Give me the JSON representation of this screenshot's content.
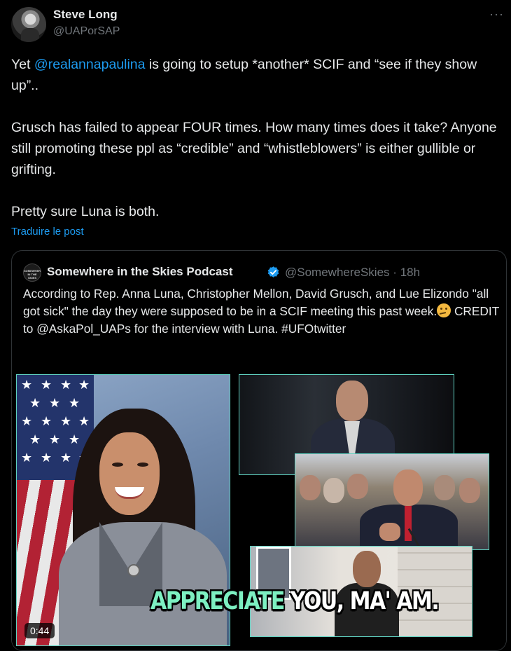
{
  "author": {
    "name": "Steve Long",
    "handle": "@UAPorSAP"
  },
  "more_icon": "more-horizontal-icon",
  "tweet": {
    "line1_prefix": "Yet ",
    "mention": "@realannapaulina",
    "line1_suffix": " is going to setup *another* SCIF and “see if they show up”..",
    "paragraph2": "Grusch has failed to appear FOUR times. How many times does it take? Anyone still promoting these ppl as “credible” and “whistleblowers” is either gullible or grifting.",
    "paragraph3": "Pretty sure Luna is both."
  },
  "translate_label": "Traduire le post",
  "quote": {
    "avatar_text": "SOMEWHERE IN THE SKIES",
    "name": "Somewhere in the Skies Podcast",
    "handle": "@SomewhereSkies",
    "separator": "·",
    "time": "18h",
    "text_before_emoji": "According to Rep. Anna Luna, Christopher Mellon, David Grusch, and Lue Elizondo \"all got sick\" the day they were supposed to be in a SCIF meeting this past week.",
    "text_after_emoji": " CREDIT to @AskaPol_UAPs for the interview with Luna. #UFOtwitter",
    "verified_color": "#1d9bf0"
  },
  "video": {
    "caption_highlight": "APPRECIATE",
    "caption_rest": " YOU, MA' AM.",
    "duration": "0:44",
    "caption_color": "#7df0c2"
  }
}
